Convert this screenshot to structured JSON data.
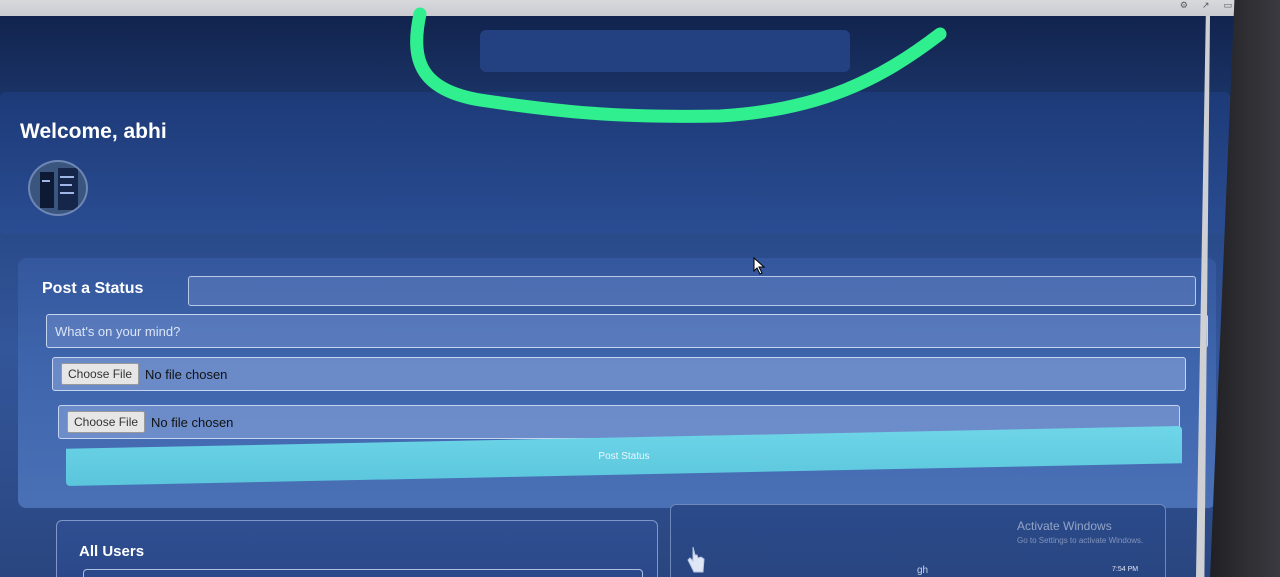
{
  "header": {
    "search_placeholder": ""
  },
  "welcome": {
    "title": "Welcome, abhi"
  },
  "status_form": {
    "title": "Post a Status",
    "input_placeholder": "What's on your mind?",
    "file_inputs": [
      {
        "button_label": "Choose File",
        "status": "No file chosen"
      },
      {
        "button_label": "Choose File",
        "status": "No file chosen"
      }
    ],
    "submit_label": "Post Status"
  },
  "users_section": {
    "title": "All Users"
  },
  "side_panel": {
    "watermark_title": "Activate Windows",
    "watermark_sub": "Go to Settings to activate Windows.",
    "text": "gh"
  },
  "taskbar": {
    "time": "7:54 PM"
  },
  "colors": {
    "annotation": "#2fef8e",
    "accent_button": "#5ac5dc",
    "page_background": "#274785"
  },
  "icons": {
    "pointer": "cursor-arrow-icon",
    "hand": "hand-icon"
  }
}
